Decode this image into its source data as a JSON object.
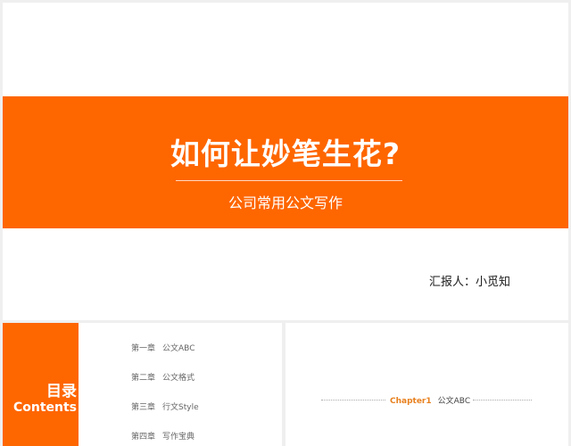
{
  "cover": {
    "title": "如何让妙笔生花?",
    "subtitle": "公司常用公文写作",
    "reporter": "汇报人：小觅知"
  },
  "contents": {
    "heading_cn": "目录",
    "heading_en": "Contents",
    "items": [
      {
        "chapter": "第一章",
        "title": "公文ABC"
      },
      {
        "chapter": "第二章",
        "title": "公文格式"
      },
      {
        "chapter": "第三章",
        "title": "行文Style"
      },
      {
        "chapter": "第四章",
        "title": "写作宝典"
      }
    ]
  },
  "chapter": {
    "number": "Chapter1",
    "name": "公文ABC"
  },
  "colors": {
    "accent": "#fe6600",
    "chapter_accent": "#e8801e"
  }
}
